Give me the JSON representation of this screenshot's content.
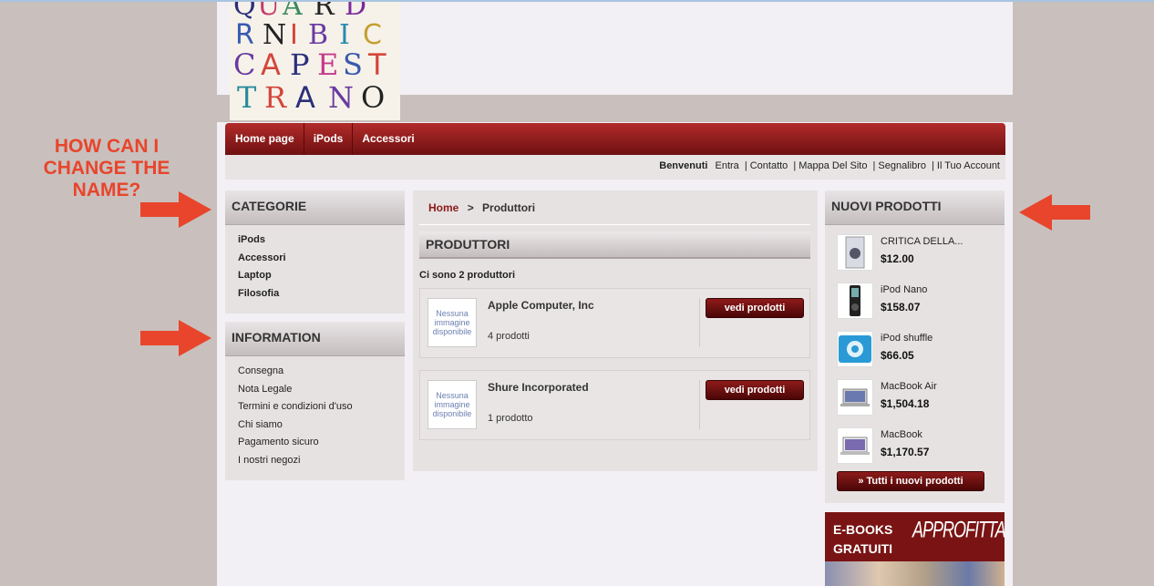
{
  "logo": {
    "alt_text": "QUARDNIBIC CAPESTRANO"
  },
  "nav": {
    "items": [
      "Home page",
      "iPods",
      "Accessori"
    ]
  },
  "subnav": {
    "welcome": "Benvenuti",
    "links": [
      "Entra",
      "Contatto",
      "Mappa Del Sito",
      "Segnalibro",
      "Il Tuo Account"
    ]
  },
  "annotation": {
    "text": "HOW CAN I CHANGE THE NAME?"
  },
  "categories": {
    "title": "CATEGORIE",
    "items": [
      "iPods",
      "Accessori",
      "Laptop",
      "Filosofia"
    ]
  },
  "information": {
    "title": "INFORMATION",
    "items": [
      "Consegna",
      "Nota Legale",
      "Termini e condizioni d'uso",
      "Chi siamo",
      "Pagamento sicuro",
      "I nostri negozi"
    ]
  },
  "breadcrumb": {
    "home": "Home",
    "separator": ">",
    "current": "Produttori"
  },
  "manufacturers": {
    "title": "PRODUTTORI",
    "count_text": "Ci sono 2 produttori",
    "no_image": "Nessuna immagine disponibile",
    "button_label": "vedi prodotti",
    "items": [
      {
        "name": "Apple Computer, Inc",
        "count": "4 prodotti"
      },
      {
        "name": "Shure Incorporated",
        "count": "1 prodotto"
      }
    ]
  },
  "new_products": {
    "title": "NUOVI PRODOTTI",
    "items": [
      {
        "name": "CRITICA DELLA...",
        "price": "$12.00"
      },
      {
        "name": "iPod Nano",
        "price": "$158.07"
      },
      {
        "name": "iPod shuffle",
        "price": "$66.05"
      },
      {
        "name": "MacBook Air",
        "price": "$1,504.18"
      },
      {
        "name": "MacBook",
        "price": "$1,170.57"
      }
    ],
    "all_button": "» Tutti i nuovi prodotti"
  },
  "ebook_banner": {
    "line1": "E-BOOKS",
    "line2": "GRATUITI",
    "slogan": "APPROFITTANE!!!"
  },
  "colors": {
    "brand_red": "#8e1b1b",
    "annotation": "#e8452c",
    "background": "#c9c0bd"
  }
}
